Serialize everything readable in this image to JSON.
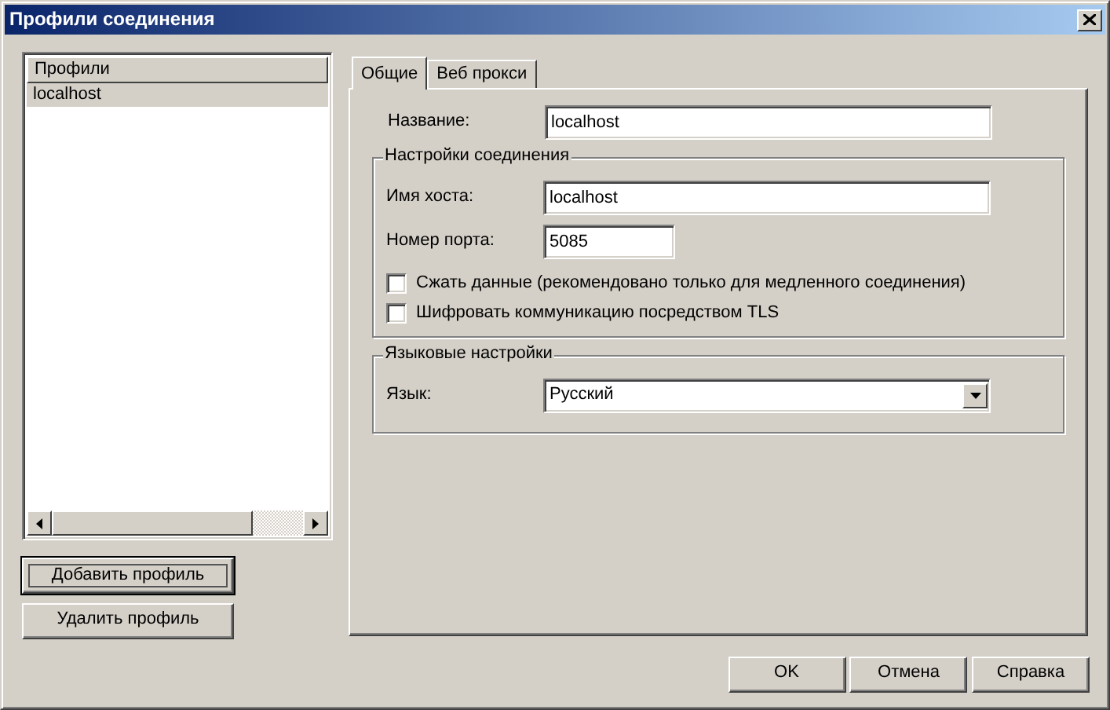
{
  "window": {
    "title": "Профили соединения"
  },
  "profiles": {
    "header": "Профили",
    "items": [
      {
        "label": "localhost",
        "selected": true
      }
    ]
  },
  "profile_buttons": [
    {
      "label": "Добавить профиль",
      "focused": true
    },
    {
      "label": "Удалить профиль",
      "focused": false
    }
  ],
  "tabs": [
    {
      "label": "Общие",
      "selected": true
    },
    {
      "label": "Веб прокси",
      "selected": false
    }
  ],
  "general": {
    "name": {
      "label": "Название:",
      "value": "localhost"
    },
    "connection": {
      "title": "Настройки соединения",
      "host": {
        "label": "Имя хоста:",
        "value": "localhost"
      },
      "port": {
        "label": "Номер порта:",
        "value": "5085"
      },
      "options": [
        {
          "label": "Сжать данные (рекомендовано только для медленного соединения)",
          "checked": false
        },
        {
          "label": "Шифровать коммуникацию посредством TLS",
          "checked": false
        }
      ]
    },
    "language": {
      "title": "Языковые настройки",
      "label": "Язык:",
      "value": "Русский"
    }
  },
  "buttons": [
    {
      "label": "OK"
    },
    {
      "label": "Отмена"
    },
    {
      "label": "Справка"
    }
  ]
}
